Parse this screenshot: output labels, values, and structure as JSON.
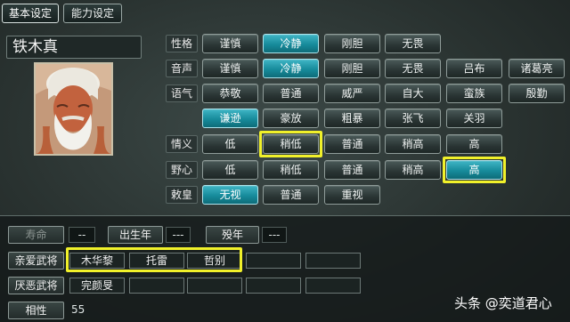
{
  "tabs": [
    "基本设定",
    "能力设定"
  ],
  "character": {
    "name": "铁木真"
  },
  "rows": [
    {
      "label": "性格",
      "options": [
        "谨慎",
        "冷静",
        "刚胆",
        "无畏"
      ],
      "selected": 1
    },
    {
      "label": "音声",
      "options": [
        "谨慎",
        "冷静",
        "刚胆",
        "无畏",
        "吕布",
        "诸葛亮"
      ],
      "selected": 1
    },
    {
      "label": "语气",
      "options": [
        "恭敬",
        "普通",
        "威严",
        "自大",
        "蛮族",
        "殷勤"
      ],
      "selected": -1
    },
    {
      "label": "",
      "options": [
        "谦逊",
        "豪放",
        "粗暴",
        "张飞",
        "关羽"
      ],
      "selected": 0
    },
    {
      "label": "情义",
      "options": [
        "低",
        "稍低",
        "普通",
        "稍高",
        "高"
      ],
      "selected": -1,
      "highlight": 1
    },
    {
      "label": "野心",
      "options": [
        "低",
        "稍低",
        "普通",
        "稍高",
        "高"
      ],
      "selected": 4,
      "highlight": 4
    },
    {
      "label": "敕皇",
      "options": [
        "无视",
        "普通",
        "重视"
      ],
      "selected": 0
    }
  ],
  "bottom": {
    "lifespan_label": "寿命",
    "lifespan_value": "--",
    "birth_label": "出生年",
    "birth_value": "---",
    "death_label": "殁年",
    "death_value": "---",
    "favored_label": "亲爱武将",
    "favored": [
      "木华黎",
      "托雷",
      "哲别",
      "",
      ""
    ],
    "disliked_label": "厌恶武将",
    "disliked": [
      "完颜旻",
      "",
      "",
      "",
      ""
    ],
    "compat_label": "相性",
    "compat_value": "55"
  },
  "watermark": "头条 @奕道君心",
  "colors": {
    "selected": "#178b9b",
    "highlight": "#f1f12a"
  }
}
